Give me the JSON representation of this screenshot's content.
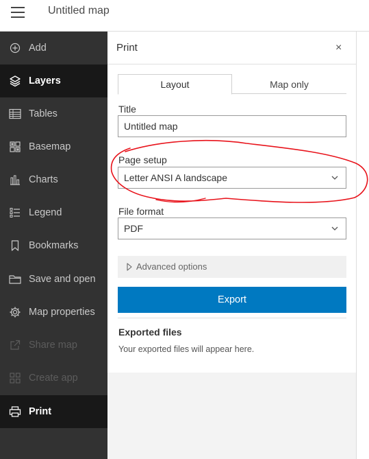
{
  "header": {
    "title": "Untitled map"
  },
  "sidebar": {
    "items": [
      {
        "label": "Add",
        "icon": "plus-circle-icon"
      },
      {
        "label": "Layers",
        "icon": "layers-icon"
      },
      {
        "label": "Tables",
        "icon": "table-icon"
      },
      {
        "label": "Basemap",
        "icon": "basemap-icon"
      },
      {
        "label": "Charts",
        "icon": "chart-icon"
      },
      {
        "label": "Legend",
        "icon": "legend-icon"
      },
      {
        "label": "Bookmarks",
        "icon": "bookmark-icon"
      },
      {
        "label": "Save and open",
        "icon": "folder-icon"
      },
      {
        "label": "Map properties",
        "icon": "gear-icon"
      },
      {
        "label": "Share map",
        "icon": "share-icon"
      },
      {
        "label": "Create app",
        "icon": "apps-icon"
      },
      {
        "label": "Print",
        "icon": "printer-icon"
      }
    ]
  },
  "print": {
    "title": "Print",
    "close": "×",
    "tabs": [
      {
        "label": "Layout"
      },
      {
        "label": "Map only"
      }
    ],
    "title_label": "Title",
    "title_value": "Untitled map",
    "page_setup_label": "Page setup",
    "page_setup_value": "Letter ANSI A landscape",
    "file_format_label": "File format",
    "file_format_value": "PDF",
    "advanced_label": "Advanced options",
    "export_label": "Export",
    "exported_title": "Exported files",
    "exported_note": "Your exported files will appear here."
  },
  "colors": {
    "accent": "#0079c1",
    "annotation": "#e8121a",
    "sidebar": "#323232"
  }
}
